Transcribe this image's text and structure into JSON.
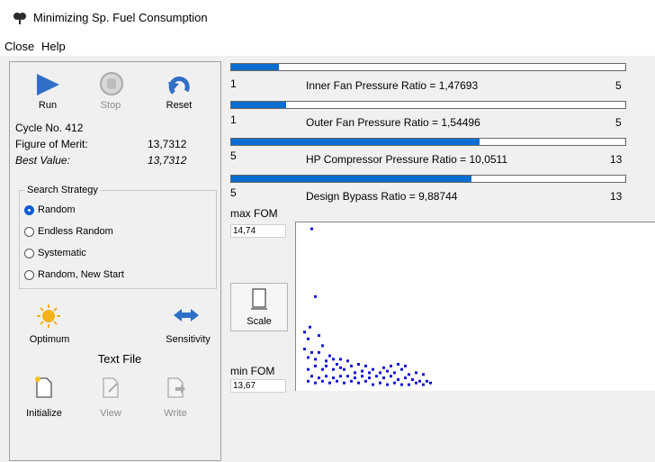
{
  "window": {
    "title": "Minimizing Sp. Fuel Consumption"
  },
  "menu": {
    "close": "Close",
    "help": "Help"
  },
  "toolbar": {
    "run": "Run",
    "stop": "Stop",
    "reset": "Reset"
  },
  "status": {
    "cycle": "Cycle No. 412",
    "fom_label": "Figure of Merit:",
    "fom_value": "13,7312",
    "best_label": "Best Value:",
    "best_value": "13,7312"
  },
  "search_strategy": {
    "title": "Search Strategy",
    "options": [
      "Random",
      "Endless Random",
      "Systematic",
      "Random, New Start"
    ],
    "selected": "Random"
  },
  "actions": {
    "optimum": "Optimum",
    "sensitivity": "Sensitivity"
  },
  "text_file": {
    "title": "Text File",
    "initialize": "Initialize",
    "view": "View",
    "write": "Write"
  },
  "parameters": [
    {
      "label": "Inner Fan Pressure Ratio = 1,47693",
      "min": "1",
      "max": "5",
      "fraction": 0.12
    },
    {
      "label": "Outer Fan Pressure Ratio = 1,54496",
      "min": "1",
      "max": "5",
      "fraction": 0.14
    },
    {
      "label": "HP Compressor Pressure Ratio = 10,0511",
      "min": "5",
      "max": "13",
      "fraction": 0.63
    },
    {
      "label": "Design Bypass Ratio = 9,88744",
      "min": "5",
      "max": "13",
      "fraction": 0.61
    }
  ],
  "plot": {
    "max_label": "max FOM",
    "max_value": "14,74",
    "min_label": "min FOM",
    "min_value": "13,67",
    "scale_label": "Scale",
    "point_color": "#1414d8",
    "points": [
      [
        0.04,
        0.03
      ],
      [
        0.05,
        0.43
      ],
      [
        0.035,
        0.61
      ],
      [
        0.02,
        0.64
      ],
      [
        0.03,
        0.68
      ],
      [
        0.06,
        0.66
      ],
      [
        0.07,
        0.72
      ],
      [
        0.02,
        0.74
      ],
      [
        0.04,
        0.76
      ],
      [
        0.06,
        0.76
      ],
      [
        0.09,
        0.78
      ],
      [
        0.03,
        0.79
      ],
      [
        0.05,
        0.8
      ],
      [
        0.08,
        0.81
      ],
      [
        0.1,
        0.8
      ],
      [
        0.12,
        0.8
      ],
      [
        0.14,
        0.81
      ],
      [
        0.05,
        0.84
      ],
      [
        0.03,
        0.86
      ],
      [
        0.07,
        0.86
      ],
      [
        0.1,
        0.86
      ],
      [
        0.12,
        0.85
      ],
      [
        0.15,
        0.84
      ],
      [
        0.17,
        0.83
      ],
      [
        0.19,
        0.84
      ],
      [
        0.04,
        0.9
      ],
      [
        0.06,
        0.91
      ],
      [
        0.08,
        0.9
      ],
      [
        0.1,
        0.91
      ],
      [
        0.12,
        0.9
      ],
      [
        0.14,
        0.9
      ],
      [
        0.16,
        0.91
      ],
      [
        0.18,
        0.9
      ],
      [
        0.2,
        0.91
      ],
      [
        0.22,
        0.9
      ],
      [
        0.24,
        0.91
      ],
      [
        0.26,
        0.9
      ],
      [
        0.28,
        0.92
      ],
      [
        0.3,
        0.91
      ],
      [
        0.32,
        0.92
      ],
      [
        0.34,
        0.93
      ],
      [
        0.36,
        0.93
      ],
      [
        0.03,
        0.93
      ],
      [
        0.05,
        0.94
      ],
      [
        0.07,
        0.93
      ],
      [
        0.09,
        0.94
      ],
      [
        0.11,
        0.93
      ],
      [
        0.13,
        0.94
      ],
      [
        0.15,
        0.93
      ],
      [
        0.17,
        0.94
      ],
      [
        0.19,
        0.93
      ],
      [
        0.21,
        0.95
      ],
      [
        0.23,
        0.94
      ],
      [
        0.25,
        0.95
      ],
      [
        0.27,
        0.94
      ],
      [
        0.29,
        0.95
      ],
      [
        0.31,
        0.95
      ],
      [
        0.33,
        0.94
      ],
      [
        0.35,
        0.95
      ],
      [
        0.37,
        0.94
      ],
      [
        0.08,
        0.84
      ],
      [
        0.11,
        0.83
      ],
      [
        0.13,
        0.86
      ],
      [
        0.18,
        0.87
      ],
      [
        0.21,
        0.86
      ],
      [
        0.23,
        0.88
      ],
      [
        0.25,
        0.87
      ],
      [
        0.27,
        0.88
      ],
      [
        0.29,
        0.86
      ],
      [
        0.31,
        0.89
      ],
      [
        0.33,
        0.88
      ],
      [
        0.35,
        0.89
      ],
      [
        0.16,
        0.88
      ],
      [
        0.2,
        0.88
      ],
      [
        0.24,
        0.85
      ],
      [
        0.26,
        0.84
      ],
      [
        0.28,
        0.83
      ],
      [
        0.3,
        0.84
      ]
    ]
  }
}
